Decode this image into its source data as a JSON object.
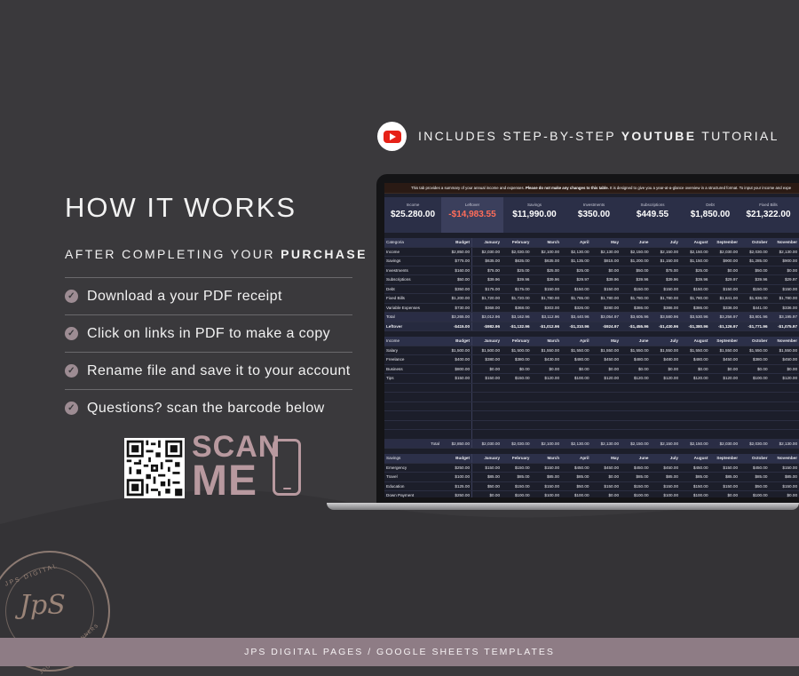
{
  "left": {
    "title": "HOW IT WORKS",
    "subtitle_prefix": "AFTER COMPLETING YOUR",
    "subtitle_bold": "PURCHASE",
    "steps": [
      {
        "label": "Download a your PDF receipt"
      },
      {
        "label": "Click on links in PDF to make a copy"
      },
      {
        "label": "Rename file and save it to your account"
      },
      {
        "label": "Questions? scan the barcode below"
      }
    ],
    "scan_line1": "SCAN",
    "scan_line2": "ME"
  },
  "youtube": {
    "prefix": "INCLUDES STEP-BY-STEP",
    "bold": "YOUTUBE",
    "suffix": "TUTORIAL"
  },
  "sheet": {
    "notice_prefix": "This tab provides a summary of your annual income and expenses.",
    "notice_bold": "Please do not make any changes to this table.",
    "notice_suffix": "It is designed to give you a year-at-a-glance overview in a structured format. To input your income and expe",
    "cards": [
      {
        "label": "Income",
        "value": "$25.280.00"
      },
      {
        "label": "Leftover",
        "value": "-$14,983.55"
      },
      {
        "label": "Savings",
        "value": "$11,990.00"
      },
      {
        "label": "Investments",
        "value": "$350.00"
      },
      {
        "label": "Subscriptions",
        "value": "$449.55"
      },
      {
        "label": "Debt",
        "value": "$1,850.00"
      },
      {
        "label": "Fixed Bills",
        "value": "$21,322.00"
      }
    ],
    "summary": {
      "headers": [
        "Categoria",
        "Budget",
        "January",
        "February",
        "March",
        "April",
        "May",
        "June",
        "July",
        "August",
        "September",
        "October",
        "November"
      ],
      "rows": [
        [
          "Income",
          "$2,850.00",
          "$2,030.00",
          "$2,030.00",
          "$2,100.00",
          "$2,130.00",
          "$2,130.00",
          "$2,150.00",
          "$2,150.00",
          "$2,150.00",
          "$2,030.00",
          "$2,030.00",
          "$2,130.00"
        ],
        [
          "Savings",
          "$775.00",
          "$635.00",
          "$635.00",
          "$635.00",
          "$1,135.00",
          "$815.00",
          "$1,200.00",
          "$1,150.00",
          "$1,150.00",
          "$900.00",
          "$1,285.00",
          "$900.00"
        ],
        [
          "Investments",
          "$160.00",
          "$75.00",
          "$25.00",
          "$25.00",
          "$25.00",
          "$0.00",
          "$50.00",
          "$75.00",
          "$25.00",
          "$0.00",
          "$50.00",
          "$0.00"
        ],
        [
          "Subscriptions",
          "$50.00",
          "$39.96",
          "$39.96",
          "$39.96",
          "$29.97",
          "$39.96",
          "$39.96",
          "$39.96",
          "$39.96",
          "$29.97",
          "$39.96",
          "$29.97"
        ],
        [
          "Debt",
          "$350.00",
          "$175.00",
          "$175.00",
          "$150.00",
          "$150.00",
          "$150.00",
          "$150.00",
          "$150.00",
          "$150.00",
          "$150.00",
          "$150.00",
          "$150.00"
        ],
        [
          "Fixed Bills",
          "$1,200.00",
          "$1,720.00",
          "$1,720.00",
          "$1,780.00",
          "$1,765.00",
          "$1,780.00",
          "$1,780.00",
          "$1,780.00",
          "$1,780.00",
          "$1,841.00",
          "$1,836.00",
          "$1,780.00"
        ],
        [
          "Variable Expenses",
          "$730.00",
          "$368.00",
          "$368.00",
          "$303.00",
          "$326.00",
          "$280.00",
          "$386.00",
          "$386.00",
          "$386.00",
          "$336.00",
          "$441.00",
          "$336.00"
        ]
      ],
      "total": [
        "Total",
        "$3,265.00",
        "$3,012.96",
        "$3,162.96",
        "$3,112.96",
        "$3,440.96",
        "$3,054.97",
        "$3,605.96",
        "$3,580.96",
        "$3,530.96",
        "$3,256.97",
        "$3,801.96",
        "$3,195.97"
      ],
      "leftover": [
        "Leftover",
        "-$415.00",
        "-$982.96",
        "-$1,132.96",
        "-$1,012.96",
        "-$1,310.96",
        "-$924.97",
        "-$1,455.96",
        "-$1,430.96",
        "-$1,380.96",
        "-$1,126.97",
        "-$1,771.96",
        "-$1,075.97"
      ]
    },
    "income": {
      "headers": [
        "Income",
        "Budget",
        "January",
        "February",
        "March",
        "April",
        "May",
        "June",
        "July",
        "August",
        "September",
        "October",
        "November"
      ],
      "rows": [
        [
          "Salary",
          "$1,500.00",
          "$1,500.00",
          "$1,500.00",
          "$1,550.00",
          "$1,550.00",
          "$1,550.00",
          "$1,550.00",
          "$1,550.00",
          "$1,550.00",
          "$1,550.00",
          "$1,550.00",
          "$1,550.00"
        ],
        [
          "Freelance",
          "$400.00",
          "$380.00",
          "$380.00",
          "$430.00",
          "$480.00",
          "$450.00",
          "$480.00",
          "$480.00",
          "$480.00",
          "$450.00",
          "$380.00",
          "$450.00"
        ],
        [
          "Business",
          "$800.00",
          "$0.00",
          "$0.00",
          "$0.00",
          "$0.00",
          "$0.00",
          "$0.00",
          "$0.00",
          "$0.00",
          "$0.00",
          "$0.00",
          "$0.00"
        ],
        [
          "Tips",
          "$150.00",
          "$150.00",
          "$150.00",
          "$120.00",
          "$100.00",
          "$120.00",
          "$120.00",
          "$120.00",
          "$120.00",
          "$120.00",
          "$100.00",
          "$120.00"
        ]
      ],
      "total": [
        "Total",
        "$2,850.00",
        "$2,030.00",
        "$2,030.00",
        "$2,100.00",
        "$2,130.00",
        "$2,130.00",
        "$2,150.00",
        "$2,150.00",
        "$2,150.00",
        "$2,030.00",
        "$2,030.00",
        "$2,130.00"
      ]
    },
    "savings": {
      "headers": [
        "Savings",
        "Budget",
        "January",
        "February",
        "March",
        "April",
        "May",
        "June",
        "July",
        "August",
        "September",
        "October",
        "November"
      ],
      "rows": [
        [
          "Emergency",
          "$250.00",
          "$150.00",
          "$150.00",
          "$150.00",
          "$450.00",
          "$450.00",
          "$450.00",
          "$450.00",
          "$450.00",
          "$150.00",
          "$450.00",
          "$150.00"
        ],
        [
          "Travel",
          "$100.00",
          "$85.00",
          "$85.00",
          "$85.00",
          "$85.00",
          "$0.00",
          "$85.00",
          "$85.00",
          "$85.00",
          "$85.00",
          "$85.00",
          "$85.00"
        ],
        [
          "Education",
          "$125.00",
          "$50.00",
          "$150.00",
          "$150.00",
          "$50.00",
          "$150.00",
          "$150.00",
          "$150.00",
          "$150.00",
          "$150.00",
          "$50.00",
          "$150.00"
        ],
        [
          "Down Payment",
          "$250.00",
          "$0.00",
          "$100.00",
          "$100.00",
          "$100.00",
          "$0.00",
          "$100.00",
          "$100.00",
          "$100.00",
          "$0.00",
          "$100.00",
          "$0.00"
        ]
      ]
    }
  },
  "stamp": {
    "ring_text": "JPS DIGITAL",
    "ring_text2": "JOURNALS & PLANNERS",
    "monogram": "JpS"
  },
  "footer": "JPS DIGITAL PAGES / GOOGLE SHEETS TEMPLATES",
  "colors": {
    "background": "#3a393c",
    "accent": "#b8999f",
    "footer": "#8e7c85",
    "negative": "#ff6d5a"
  }
}
